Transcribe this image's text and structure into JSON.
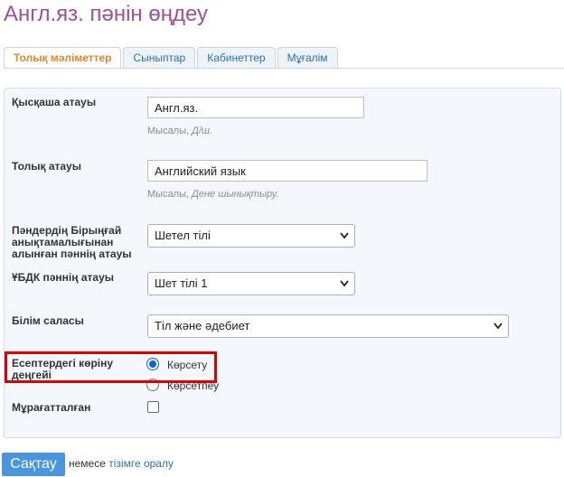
{
  "page_title": "Англ.яз. пәнін өңдеу",
  "tabs": [
    {
      "label": "Толық мәліметтер",
      "active": true
    },
    {
      "label": "Сыныптар",
      "active": false
    },
    {
      "label": "Кабинеттер",
      "active": false
    },
    {
      "label": "Мұғалім",
      "active": false
    }
  ],
  "form": {
    "short_name": {
      "label": "Қысқаша атауы",
      "value": "Англ.яз.",
      "hint_prefix": "Мысалы, ",
      "hint_example": "Д/ш."
    },
    "full_name": {
      "label": "Толық атауы",
      "value": "Английский язык",
      "hint_prefix": "Мысалы, ",
      "hint_example": "Дене шынықтыру."
    },
    "unified_ref": {
      "label": "Пәндердің Бірыңғай анықтамалығынан алынған пәннің атауы",
      "value": "Шетел тілі"
    },
    "ubdk": {
      "label": "ҰБДК пәннің атауы",
      "value": "Шет тілі 1"
    },
    "field": {
      "label": "Білім саласы",
      "value": "Тіл және әдебиет"
    },
    "visibility": {
      "label": "Есептердегі көріну деңгейі",
      "option_show": "Көрсету",
      "option_hide": "Көрсетпеу",
      "selected": "Көрсету"
    },
    "archived": {
      "label": "Мұрағатталған",
      "checked": false
    }
  },
  "footer": {
    "save_label": "Сақтау",
    "or_text": "немесе",
    "back_link": "тізімге оралу"
  },
  "colors": {
    "title": "#a04f9c",
    "active_tab": "#e0872b",
    "link": "#2d6fb5",
    "save_button": "#4a95df",
    "highlight": "#e00000"
  }
}
